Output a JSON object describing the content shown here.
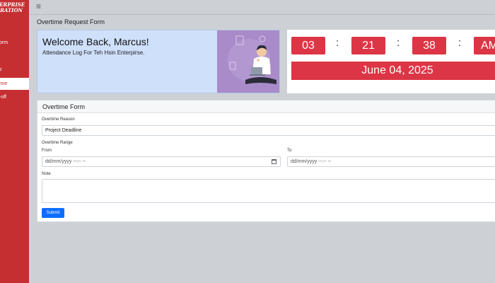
{
  "sidebar": {
    "brand_line1": "TERPRISE",
    "brand_line2": "ORATION",
    "items": [
      {
        "label": "orm"
      },
      {
        "label": "s"
      },
      {
        "label": "ime"
      },
      {
        "label": "-off"
      }
    ]
  },
  "page_title": "Overtime Request Form",
  "welcome": {
    "title": "Welcome Back, Marcus!",
    "subtitle": "Attendance Log For Teh Hsin Enterpirse."
  },
  "clock": {
    "hours": "03",
    "minutes": "21",
    "seconds": "38",
    "ampm": "AM",
    "date": "June 04, 2025"
  },
  "form": {
    "header": "Overtime Form",
    "reason_label": "Overtime Reason",
    "reason_value": "Project Deadline",
    "range_label": "Overtime Range",
    "from_label": "From",
    "from_placeholder": "dd/mm/yyyy --:-- --",
    "to_label": "To",
    "to_placeholder": "dd/mm/yyyy --:-- --",
    "note_label": "Note",
    "submit_label": "Submit"
  },
  "colors": {
    "sidebar": "#c62f32",
    "accent_red": "#dc3545",
    "submit_blue": "#0d6efd",
    "welcome_bg": "#cfe0fb",
    "illustration_bg": "#a98bc9"
  }
}
